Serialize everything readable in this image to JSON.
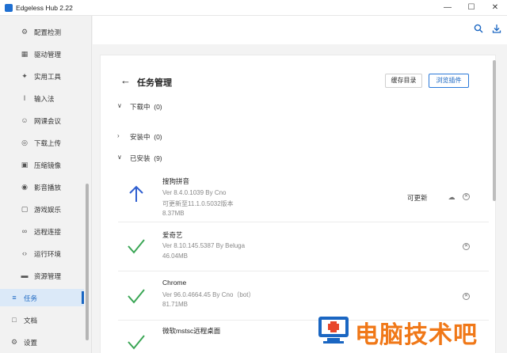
{
  "window": {
    "title": "Edgeless Hub 2.22",
    "controls": [
      "minimize-icon",
      "maximize-icon",
      "close-icon"
    ]
  },
  "sidebar": {
    "items": [
      {
        "label": "配置检测",
        "icon": "gear-icon"
      },
      {
        "label": "驱动管理",
        "icon": "driver-icon"
      },
      {
        "label": "实用工具",
        "icon": "wrench-icon"
      },
      {
        "label": "输入法",
        "icon": "text-cursor-icon"
      },
      {
        "label": "网课会议",
        "icon": "people-icon"
      },
      {
        "label": "下载上传",
        "icon": "globe-icon"
      },
      {
        "label": "压缩镜像",
        "icon": "archive-icon"
      },
      {
        "label": "影音播放",
        "icon": "film-icon"
      },
      {
        "label": "游戏娱乐",
        "icon": "gamepad-icon"
      },
      {
        "label": "远程连接",
        "icon": "link-icon"
      },
      {
        "label": "运行环境",
        "icon": "code-icon"
      },
      {
        "label": "资源管理",
        "icon": "folder-icon"
      },
      {
        "label": "任务",
        "icon": "list-icon",
        "active": true
      },
      {
        "label": "文档",
        "icon": "document-icon"
      },
      {
        "label": "设置",
        "icon": "settings-icon"
      }
    ]
  },
  "topbar": {
    "icons": [
      "search-icon",
      "download-icon"
    ]
  },
  "page": {
    "title": "任务管理",
    "buttons": {
      "cache_dir": "缓存目录",
      "browse_plugins": "浏览插件"
    }
  },
  "sections": [
    {
      "label": "下载中",
      "count": "(0)",
      "expanded": false
    },
    {
      "label": "安装中",
      "count": "(0)",
      "expanded": false
    },
    {
      "label": "已安装",
      "count": "(9)",
      "expanded": true
    }
  ],
  "installed": [
    {
      "name": "搜狗拼音",
      "version": "Ver 8.4.0.1039 By Cno",
      "update": "可更新至11.1.0.5032版本",
      "size": "8.37MB",
      "status_icon": "arrow-up-icon",
      "action_label": "可更新"
    },
    {
      "name": "爱奇艺",
      "version": "Ver 8.10.145.5387 By Beluga",
      "update": "",
      "size": "46.04MB",
      "status_icon": "checkmark-icon",
      "action_label": ""
    },
    {
      "name": "Chrome",
      "version": "Ver 96.0.4664.45 By Cno（bot）",
      "update": "",
      "size": "81.71MB",
      "status_icon": "checkmark-icon",
      "action_label": ""
    },
    {
      "name": "微软mstsc远程桌面",
      "version": "",
      "update": "",
      "size": "",
      "status_icon": "checkmark-icon",
      "action_label": ""
    }
  ],
  "watermark": {
    "text": "电脑技术吧"
  },
  "colors": {
    "accent": "#1a66c2",
    "check": "#3aa655",
    "arrow": "#2f5fd0",
    "watermark": "#f07818"
  }
}
